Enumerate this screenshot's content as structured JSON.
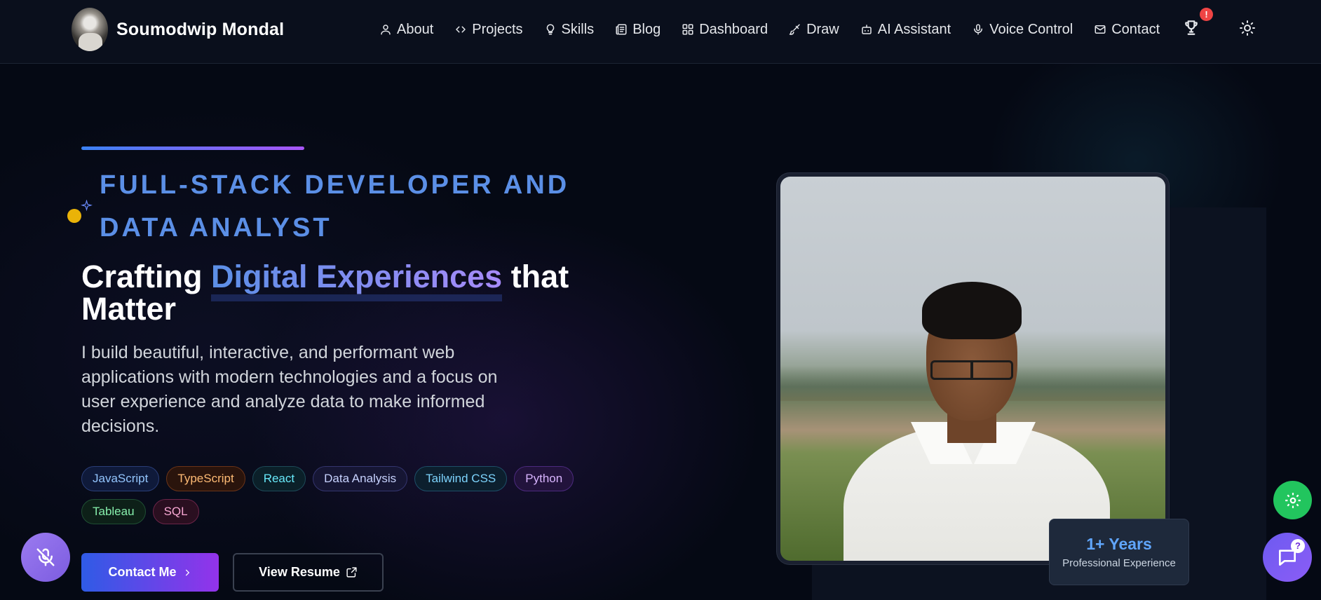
{
  "brand": {
    "name": "Soumodwip Mondal"
  },
  "nav": {
    "items": [
      {
        "label": "About",
        "icon": "user-icon"
      },
      {
        "label": "Projects",
        "icon": "code-icon"
      },
      {
        "label": "Skills",
        "icon": "lightbulb-icon"
      },
      {
        "label": "Blog",
        "icon": "newspaper-icon"
      },
      {
        "label": "Dashboard",
        "icon": "grid-icon"
      },
      {
        "label": "Draw",
        "icon": "brush-icon"
      },
      {
        "label": "AI Assistant",
        "icon": "bot-icon"
      },
      {
        "label": "Voice Control",
        "icon": "mic-icon"
      },
      {
        "label": "Contact",
        "icon": "mail-icon"
      }
    ],
    "achievements_badge": "!",
    "theme_icon": "sun-icon"
  },
  "hero": {
    "role": "FULL-STACK DEVELOPER AND DATA ANALYST",
    "headline_pre": "Crafting ",
    "headline_highlight": "Digital Experiences",
    "headline_post": " that Matter",
    "description": "I build beautiful, interactive, and performant web applications with modern technologies and a focus on user experience and analyze data to make informed decisions.",
    "tags": [
      {
        "label": "JavaScript",
        "color": "#93c5fd",
        "bg": "#0f1a3a",
        "border": "#2a3e78"
      },
      {
        "label": "TypeScript",
        "color": "#fdba74",
        "bg": "#2a140c",
        "border": "#6b3418"
      },
      {
        "label": "React",
        "color": "#67e8f9",
        "bg": "#0b2029",
        "border": "#1d4a58"
      },
      {
        "label": "Data Analysis",
        "color": "#c7d2fe",
        "bg": "#161634",
        "border": "#34356e"
      },
      {
        "label": "Tailwind CSS",
        "color": "#7dd3fc",
        "bg": "#0c1f2e",
        "border": "#1e4e68"
      },
      {
        "label": "Python",
        "color": "#d8b4fe",
        "bg": "#22133c",
        "border": "#4c2a7e"
      },
      {
        "label": "Tableau",
        "color": "#86efac",
        "bg": "#0d2018",
        "border": "#1f4e33"
      },
      {
        "label": "SQL",
        "color": "#f9a8d4",
        "bg": "#2a0f20",
        "border": "#6b2448"
      }
    ],
    "contact_button": "Contact Me",
    "resume_button": "View Resume"
  },
  "experience": {
    "years": "1+ Years",
    "label": "Professional Experience"
  },
  "floating": {
    "chat_badge": "?"
  }
}
